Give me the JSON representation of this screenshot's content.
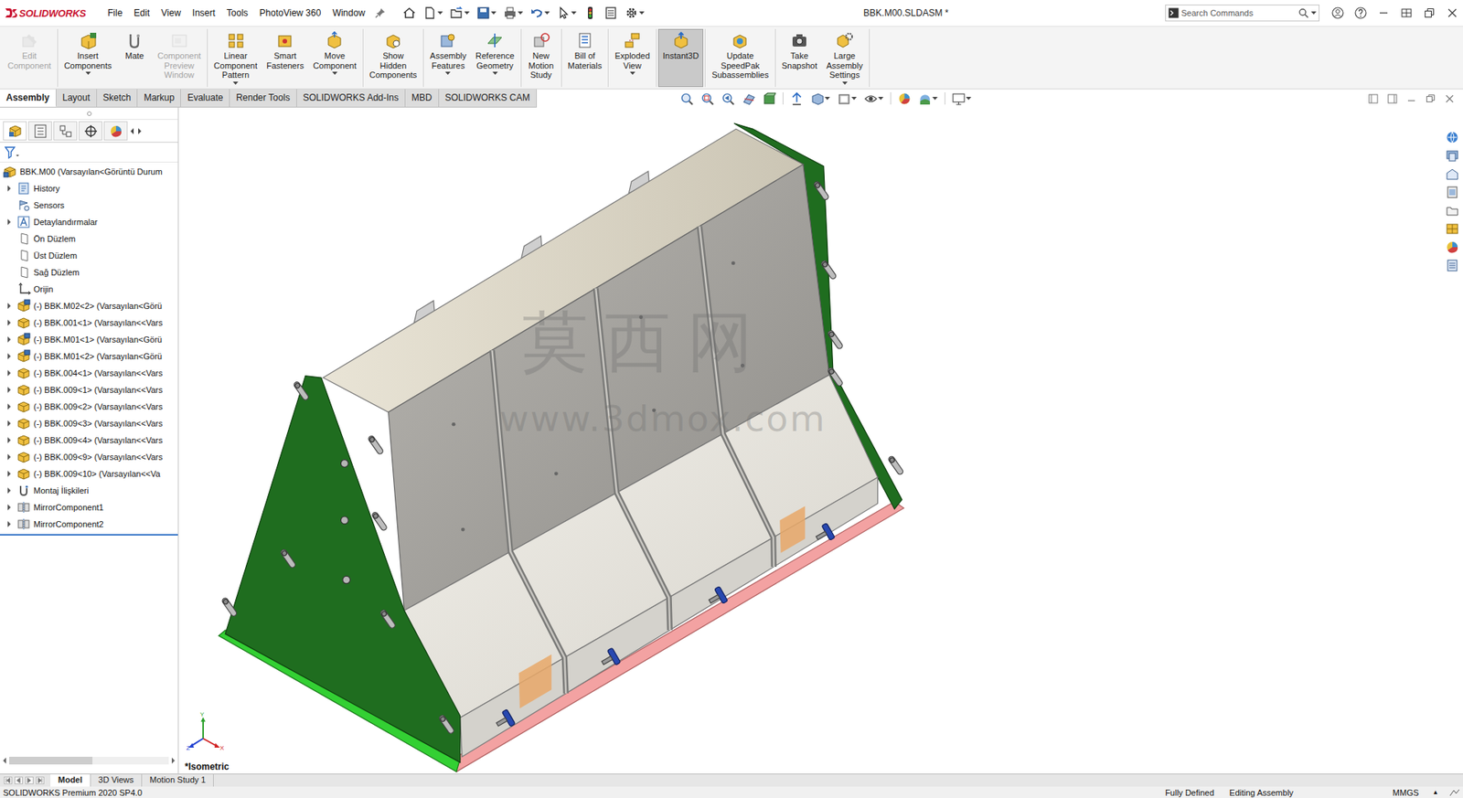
{
  "app": {
    "logo": "SOLIDWORKS"
  },
  "menu": [
    "File",
    "Edit",
    "View",
    "Insert",
    "Tools",
    "PhotoView 360",
    "Window"
  ],
  "window": {
    "title": "BBK.M00.SLDASM *"
  },
  "search": {
    "placeholder": "Search Commands"
  },
  "ribbon": [
    [
      {
        "label": "Edit Component",
        "disabled": true,
        "selected": false,
        "dropdown": false
      }
    ],
    [
      {
        "label": "Insert Components",
        "disabled": false,
        "selected": false,
        "dropdown": true
      },
      {
        "label": "Mate",
        "disabled": false,
        "selected": false,
        "dropdown": false
      },
      {
        "label": "Component Preview Window",
        "disabled": true,
        "selected": false,
        "dropdown": false
      }
    ],
    [
      {
        "label": "Linear Component Pattern",
        "disabled": false,
        "selected": false,
        "dropdown": true
      },
      {
        "label": "Smart Fasteners",
        "disabled": false,
        "selected": false,
        "dropdown": false
      },
      {
        "label": "Move Component",
        "disabled": false,
        "selected": false,
        "dropdown": true
      }
    ],
    [
      {
        "label": "Show Hidden Components",
        "disabled": false,
        "selected": false,
        "dropdown": false
      }
    ],
    [
      {
        "label": "Assembly Features",
        "disabled": false,
        "selected": false,
        "dropdown": true
      },
      {
        "label": "Reference Geometry",
        "disabled": false,
        "selected": false,
        "dropdown": true
      }
    ],
    [
      {
        "label": "New Motion Study",
        "disabled": false,
        "selected": false,
        "dropdown": false
      }
    ],
    [
      {
        "label": "Bill of Materials",
        "disabled": false,
        "selected": false,
        "dropdown": false
      }
    ],
    [
      {
        "label": "Exploded View",
        "disabled": false,
        "selected": false,
        "dropdown": true
      }
    ],
    [
      {
        "label": "Instant3D",
        "disabled": false,
        "selected": true,
        "dropdown": false
      }
    ],
    [
      {
        "label": "Update SpeedPak Subassemblies",
        "disabled": false,
        "selected": false,
        "dropdown": false
      }
    ],
    [
      {
        "label": "Take Snapshot",
        "disabled": false,
        "selected": false,
        "dropdown": false
      },
      {
        "label": "Large Assembly Settings",
        "disabled": false,
        "selected": false,
        "dropdown": true
      }
    ]
  ],
  "tabs": [
    {
      "label": "Assembly",
      "selected": true
    },
    {
      "label": "Layout",
      "selected": false
    },
    {
      "label": "Sketch",
      "selected": false
    },
    {
      "label": "Markup",
      "selected": false
    },
    {
      "label": "Evaluate",
      "selected": false
    },
    {
      "label": "Render Tools",
      "selected": false
    },
    {
      "label": "SOLIDWORKS Add-Ins",
      "selected": false
    },
    {
      "label": "MBD",
      "selected": false
    },
    {
      "label": "SOLIDWORKS CAM",
      "selected": false
    }
  ],
  "tree": {
    "root": "BBK.M00 (Varsayılan<Görüntü Durum",
    "items": [
      {
        "label": "History",
        "kind": "history",
        "expandable": true
      },
      {
        "label": "Sensors",
        "kind": "sensor",
        "expandable": false
      },
      {
        "label": "Detaylandırmalar",
        "kind": "annotation",
        "expandable": true
      },
      {
        "label": "Ön Düzlem",
        "kind": "plane",
        "expandable": false
      },
      {
        "label": "Üst Düzlem",
        "kind": "plane",
        "expandable": false
      },
      {
        "label": "Sağ Düzlem",
        "kind": "plane",
        "expandable": false
      },
      {
        "label": "Orijin",
        "kind": "origin",
        "expandable": false
      },
      {
        "label": "(-) BBK.M02<2> (Varsayılan<Görü",
        "kind": "assembly",
        "expandable": true
      },
      {
        "label": "(-) BBK.001<1> (Varsayılan<<Vars",
        "kind": "part",
        "expandable": true
      },
      {
        "label": "(-) BBK.M01<1> (Varsayılan<Görü",
        "kind": "assembly",
        "expandable": true
      },
      {
        "label": "(-) BBK.M01<2> (Varsayılan<Görü",
        "kind": "assembly",
        "expandable": true
      },
      {
        "label": "(-) BBK.004<1> (Varsayılan<<Vars",
        "kind": "part",
        "expandable": true
      },
      {
        "label": "(-) BBK.009<1> (Varsayılan<<Vars",
        "kind": "part",
        "expandable": true
      },
      {
        "label": "(-) BBK.009<2> (Varsayılan<<Vars",
        "kind": "part",
        "expandable": true
      },
      {
        "label": "(-) BBK.009<3> (Varsayılan<<Vars",
        "kind": "part",
        "expandable": true
      },
      {
        "label": "(-) BBK.009<4> (Varsayılan<<Vars",
        "kind": "part",
        "expandable": true
      },
      {
        "label": "(-) BBK.009<9> (Varsayılan<<Vars",
        "kind": "part",
        "expandable": true
      },
      {
        "label": "(-) BBK.009<10> (Varsayılan<<Va",
        "kind": "part",
        "expandable": true
      },
      {
        "label": "Montaj İlişkileri",
        "kind": "mates",
        "expandable": true
      },
      {
        "label": "MirrorComponent1",
        "kind": "mirror",
        "expandable": true
      },
      {
        "label": "MirrorComponent2",
        "kind": "mirror",
        "expandable": true
      }
    ]
  },
  "viewport": {
    "view_label": "*Isometric",
    "watermark": [
      "莫西网",
      "www.3dmox.com"
    ],
    "triad": [
      "Y",
      "Z",
      "X"
    ]
  },
  "bottom_tabs": [
    {
      "label": "Model",
      "selected": true
    },
    {
      "label": "3D Views",
      "selected": false
    },
    {
      "label": "Motion Study 1",
      "selected": false
    }
  ],
  "status_bar": {
    "product": "SOLIDWORKS Premium 2020 SP4.0",
    "state": "Fully Defined",
    "mode": "Editing Assembly",
    "units": "MMGS",
    "units_arrow": "▲"
  }
}
